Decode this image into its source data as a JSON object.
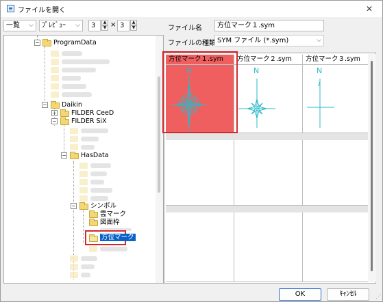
{
  "window": {
    "title": "ファイルを開く",
    "close_glyph": "✕"
  },
  "toolbar": {
    "view_mode": "一覧",
    "preview_mode": "ﾌﾟﾚﾋﾞｭｰ",
    "columns": "3",
    "times": "×",
    "rows": "3",
    "chevron": "⌵",
    "up_glyph": "▲",
    "down_glyph": "▼"
  },
  "tree": {
    "nodes": [
      {
        "label": "ProgramData",
        "expander": "−"
      },
      {
        "label": "Daikin",
        "expander": "−"
      },
      {
        "label": "FILDER CeeD",
        "expander": "+"
      },
      {
        "label": "FILDER SiX",
        "expander": "−"
      },
      {
        "label": "HasData",
        "expander": "−"
      },
      {
        "label": "シンボル",
        "expander": "−"
      },
      {
        "label": "雲マーク",
        "expander": ""
      },
      {
        "label": "図面枠",
        "expander": ""
      },
      {
        "label": "方位マーク",
        "expander": "",
        "selected": true
      }
    ]
  },
  "file_name": {
    "label": "ファイル名",
    "value": "方位マーク１.sym"
  },
  "file_type": {
    "label": "ファイルの種類",
    "value": "SYM ファイル (*.sym)"
  },
  "grid": {
    "cells": [
      {
        "name": "方位マーク１.sym",
        "highlighted": true,
        "symbol_letter": "N"
      },
      {
        "name": "方位マーク２.sym",
        "highlighted": false,
        "symbol_letter": "N"
      },
      {
        "name": "方位マーク３.sym",
        "highlighted": false,
        "symbol_letter": "N"
      }
    ]
  },
  "buttons": {
    "ok": "OK",
    "cancel": "ｷｬﾝｾﾙ"
  },
  "colors": {
    "highlight": "#f05f5f",
    "annotation_red": "#d3292d",
    "symbol_cyan": "#2bb8c9",
    "selection_blue": "#0a64c8"
  }
}
